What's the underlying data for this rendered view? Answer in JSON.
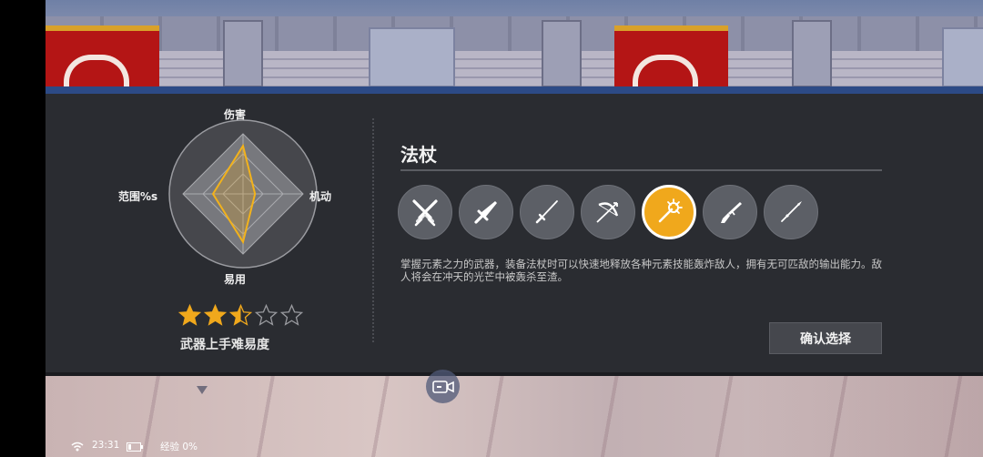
{
  "radar": {
    "labels": {
      "top": "伤害",
      "right": "机动",
      "bottom": "易用",
      "left": "范围%s"
    },
    "values": {
      "top": 0.8,
      "right": 0.2,
      "bottom": 0.8,
      "left": 0.5
    }
  },
  "difficulty": {
    "rating": 2.5,
    "max": 5,
    "label": "武器上手难易度"
  },
  "weapon": {
    "title": "法杖",
    "description": "掌握元素之力的武器，装备法杖时可以快速地释放各种元素技能轰炸敌人，拥有无可匹敌的输出能力。敌人将会在冲天的光芒中被轰杀至渣。",
    "confirm_label": "确认选择",
    "icons": [
      {
        "name": "dual-blades-icon",
        "selected": false
      },
      {
        "name": "greatsword-icon",
        "selected": false
      },
      {
        "name": "katana-icon",
        "selected": false
      },
      {
        "name": "bow-icon",
        "selected": false
      },
      {
        "name": "staff-icon",
        "selected": true
      },
      {
        "name": "gun-icon",
        "selected": false
      },
      {
        "name": "spear-icon",
        "selected": false
      }
    ]
  },
  "colors": {
    "panel": "#2a2c31",
    "accent": "#f0a81c",
    "radar_fill": "#7b7c81",
    "radar_line": "#f2b21c",
    "header_bar": "#2c4a86"
  },
  "status_bar": {
    "time": "23:31",
    "exp": "经验 0%"
  }
}
